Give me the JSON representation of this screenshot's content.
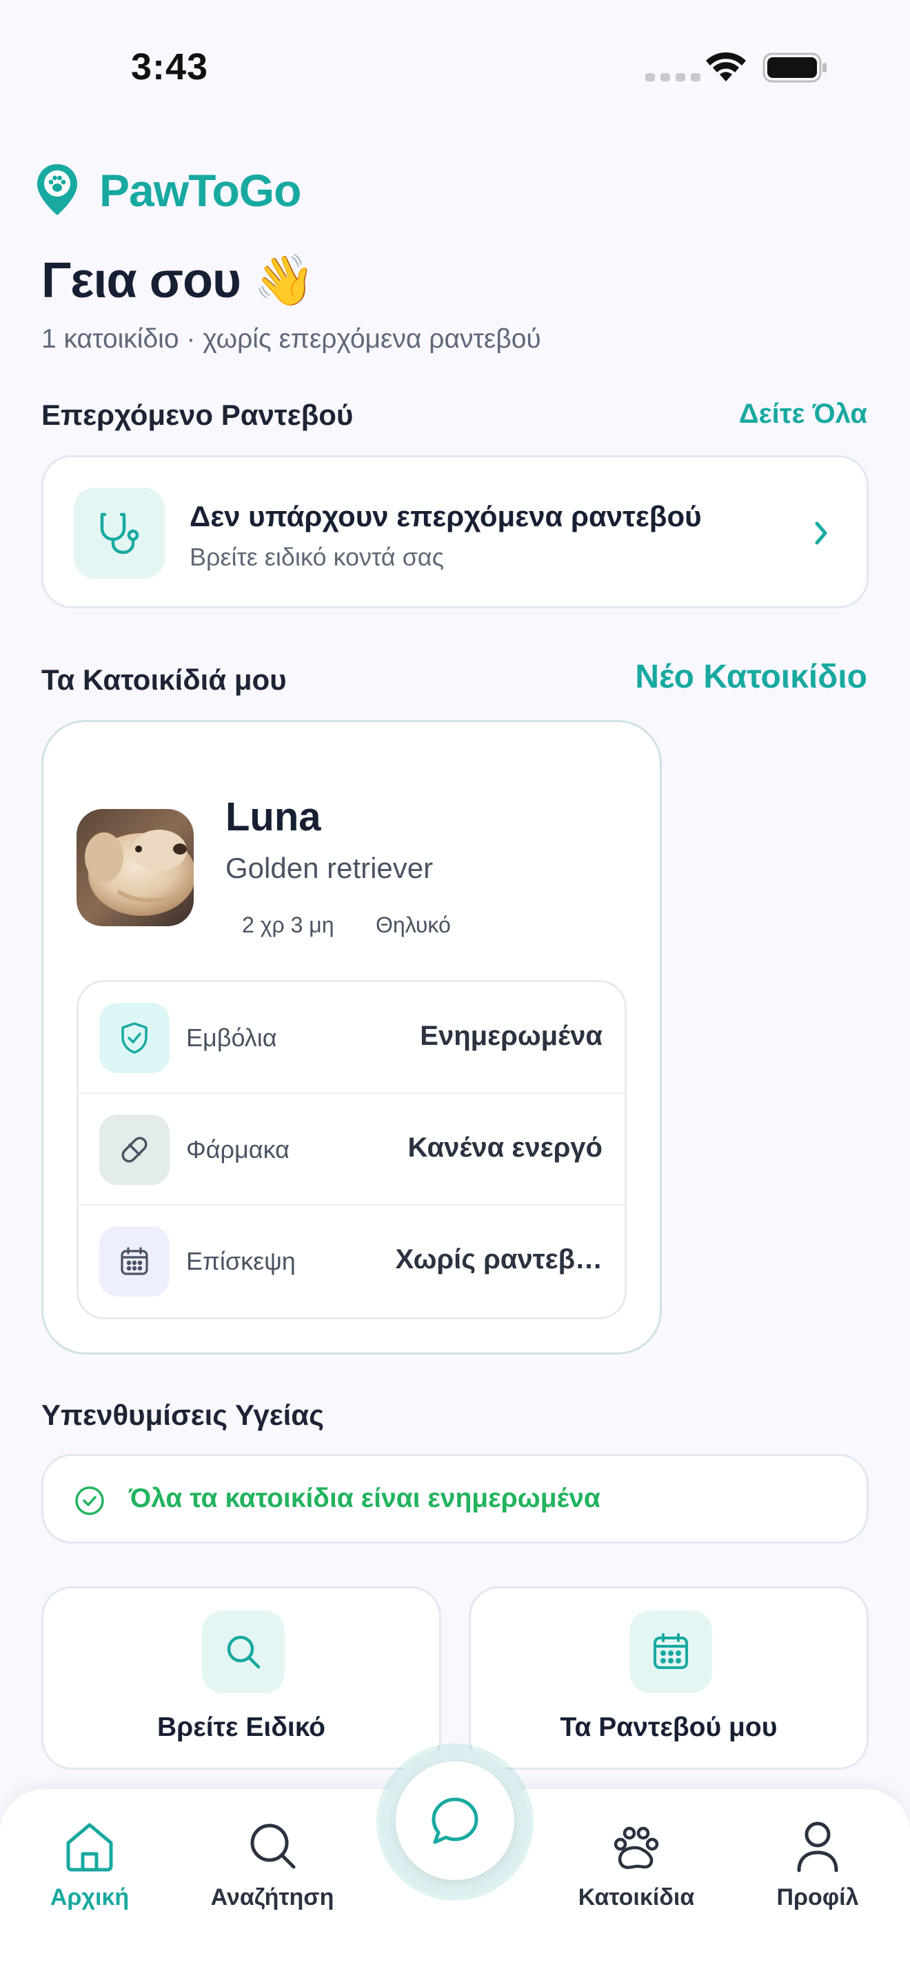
{
  "status_bar": {
    "time": "3:43"
  },
  "brand": {
    "name": "PawToGo",
    "icon": "map-pin-paw-icon"
  },
  "header": {
    "greeting": "Γεια σου 👋",
    "subtitle": "1 κατοικίδιο · χωρίς επερχόμενα ραντεβού"
  },
  "appointments": {
    "title": "Επερχόμενο Ραντεβού",
    "see_all": "Δείτε Όλα",
    "empty_title": "Δεν υπάρχουν επερχόμενα ραντεβού",
    "empty_subtitle": "Βρείτε ειδικό κοντά σας",
    "icon": "stethoscope-icon"
  },
  "pets": {
    "title": "Τα Κατοικίδιά μου",
    "new_pet": "Νέο Κατοικίδιο",
    "items": [
      {
        "name": "Luna",
        "breed": "Golden retriever",
        "age": "2 χρ 3 μη",
        "sex": "Θηλυκό",
        "stats": [
          {
            "icon": "shield-check-icon",
            "label": "Εμβόλια",
            "value": "Ενημερωμένα"
          },
          {
            "icon": "pill-icon",
            "label": "Φάρμακα",
            "value": "Κανένα ενεργό"
          },
          {
            "icon": "calendar-icon",
            "label": "Επίσκεψη",
            "value": "Χωρίς ραντεβ…"
          }
        ]
      }
    ]
  },
  "reminders": {
    "title": "Υπενθυμίσεις Υγείας",
    "message": "Όλα τα κατοικίδια είναι ενημερωμένα"
  },
  "quick_actions": [
    {
      "label": "Βρείτε Ειδικό",
      "icon": "search-icon"
    },
    {
      "label": "Τα Ραντεβού μου",
      "icon": "calendar-icon"
    }
  ],
  "bottom_nav": {
    "items": [
      {
        "label": "Αρχική",
        "icon": "home-icon",
        "active": true
      },
      {
        "label": "Αναζήτηση",
        "icon": "search-icon",
        "active": false
      },
      {
        "label": "Κατοικίδια",
        "icon": "paw-icon",
        "active": false
      },
      {
        "label": "Προφίλ",
        "icon": "user-icon",
        "active": false
      }
    ],
    "center_action": {
      "icon": "chat-bubble-icon"
    }
  },
  "colors": {
    "accent": "#18A9A0",
    "success": "#22B35E",
    "background": "#F8F8FE",
    "text": "#172033"
  }
}
